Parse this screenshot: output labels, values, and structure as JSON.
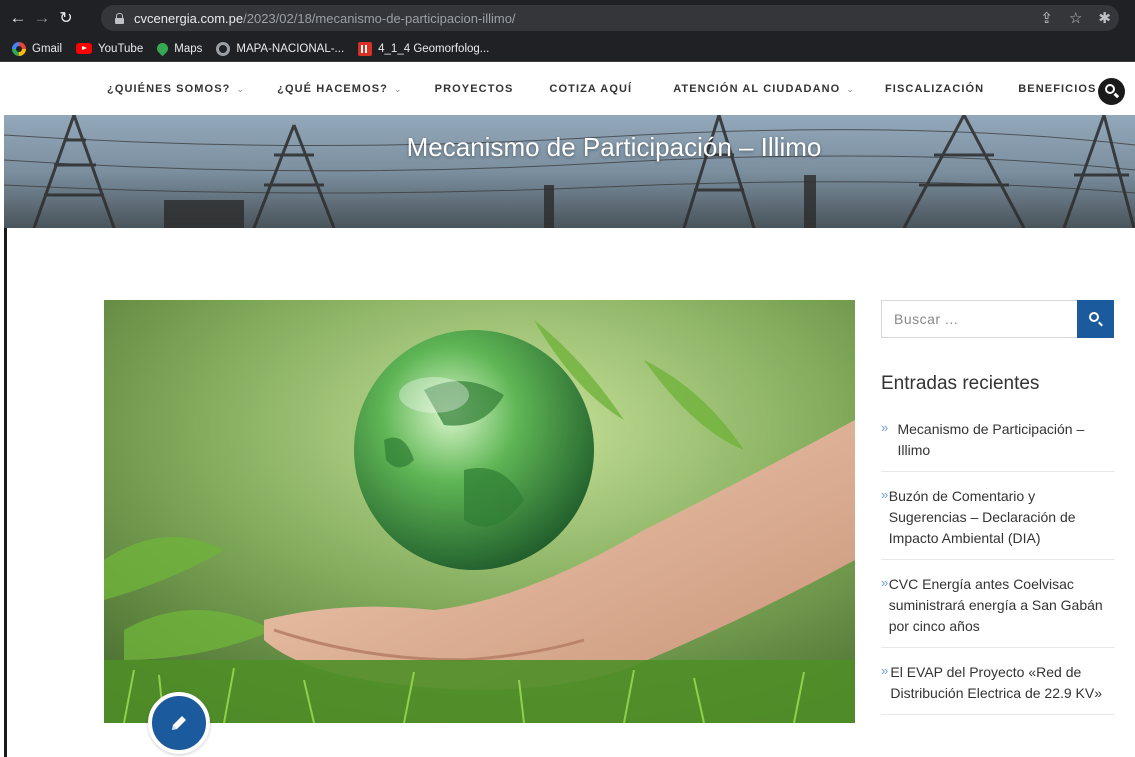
{
  "browser": {
    "url_host": "cvcenergia.com.pe",
    "url_path": "/2023/02/18/mecanismo-de-participacion-illimo/",
    "bookmarks": [
      {
        "label": "Gmail",
        "icon": "gmail-icon"
      },
      {
        "label": "YouTube",
        "icon": "youtube-icon"
      },
      {
        "label": "Maps",
        "icon": "maps-icon"
      },
      {
        "label": "MAPA-NACIONAL-...",
        "icon": "globe-icon"
      },
      {
        "label": "4_1_4 Geomorfolog...",
        "icon": "document-icon"
      }
    ]
  },
  "nav": {
    "items": [
      {
        "label": "¿QUIÉNES SOMOS?",
        "has_dropdown": true
      },
      {
        "label": "¿QUÉ HACEMOS?",
        "has_dropdown": true
      },
      {
        "label": "PROYECTOS",
        "has_dropdown": false
      },
      {
        "label": "COTIZA AQUÍ",
        "has_dropdown": false
      },
      {
        "label": "ATENCIÓN AL CIUDADANO",
        "has_dropdown": true
      },
      {
        "label": "FISCALIZACIÓN",
        "has_dropdown": false
      },
      {
        "label": "BENEFICIOS",
        "has_dropdown": true
      }
    ],
    "caret": "⌄"
  },
  "hero": {
    "title": "Mecanismo de Participación – Illimo"
  },
  "sidebar": {
    "search_placeholder": "Buscar ...",
    "recent_title": "Entradas recientes",
    "recent_posts": [
      "Mecanismo de Participación – Illimo",
      "Buzón de Comentario y Sugerencias – Declaración de Impacto Ambiental (DIA)",
      "CVC Energía antes Coelvisac suministrará energía a San Gabán por cinco años",
      "El EVAP del Proyecto «Red de Distribución Electrica de 22.9 KV»"
    ]
  },
  "colors": {
    "accent": "#1c5a9e",
    "bullet": "#6e9cd1"
  }
}
